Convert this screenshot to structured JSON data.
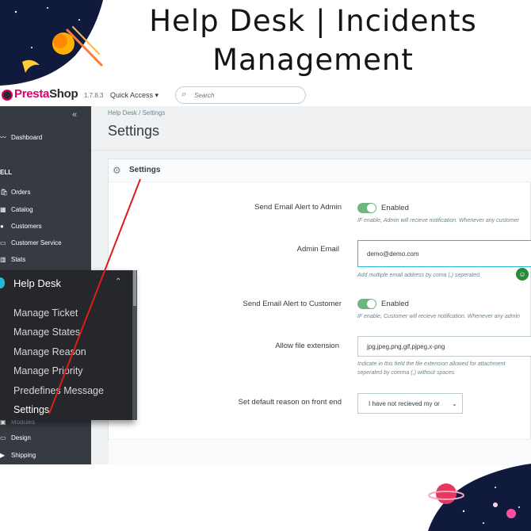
{
  "headline": {
    "line1": "Help Desk | Incidents",
    "line2": "Management"
  },
  "header": {
    "brand_presta": "Presta",
    "brand_shop": "Shop",
    "version": "1.7.8.3",
    "quick_access": "Quick Access ▾",
    "search_placeholder": "Search"
  },
  "sidebar": {
    "collapse": "«",
    "items": [
      {
        "icon": "〰",
        "label": "Dashboard"
      },
      {
        "icon": "🛍",
        "label": "Orders"
      },
      {
        "icon": "▦",
        "label": "Catalog"
      },
      {
        "icon": "●",
        "label": "Customers"
      },
      {
        "icon": "▭",
        "label": "Customer Service"
      },
      {
        "icon": "▥",
        "label": "Stats"
      },
      {
        "icon": "▣",
        "label": "Modules"
      },
      {
        "icon": "▭",
        "label": "Design"
      },
      {
        "icon": "▶",
        "label": "Shipping"
      }
    ],
    "section_sell": "ELL"
  },
  "popup": {
    "title": "Help Desk",
    "chevron": "⌃",
    "items": [
      {
        "label": "Manage Ticket"
      },
      {
        "label": "Manage States"
      },
      {
        "label": "Manage Reason"
      },
      {
        "label": "Manage Priority"
      },
      {
        "label": "Predefines Message"
      },
      {
        "label": "Settings"
      }
    ]
  },
  "main": {
    "breadcrumb": "Help Desk  /   Settings",
    "page_title": "Settings",
    "panel_title": "Settings",
    "fields": {
      "alert_admin_label": "Send Email Alert to Admin",
      "alert_admin_state": "Enabled",
      "alert_admin_help": "IF enable, Admin will recieve notification. Whenever any customer",
      "admin_email_label": "Admin Email",
      "admin_email_value": "demo@demo.com",
      "admin_email_help": "Add multiple email address by coma (,) seperated.",
      "alert_customer_label": "Send Email Alert to Customer",
      "alert_customer_state": "Enabled",
      "alert_customer_help": "IF enable, Customer will recieve notification. Whenever any admin",
      "file_ext_label": "Allow file extension",
      "file_ext_value": "jpg,jpeg,png,gif,pjpeg,x-png",
      "file_ext_help_1": "Indicate in this field the file extension allowed for attachment",
      "file_ext_help_2": "seperated by comma (,) without spaces.",
      "default_reason_label": "Set default reason on front end",
      "default_reason_value": "I have not recieved my or"
    }
  },
  "colors": {
    "accent": "#25b9d7",
    "toggle_on": "#70b580",
    "sidebar": "#363a41",
    "brand": "#df0067",
    "annotation": "#e01b1b"
  }
}
